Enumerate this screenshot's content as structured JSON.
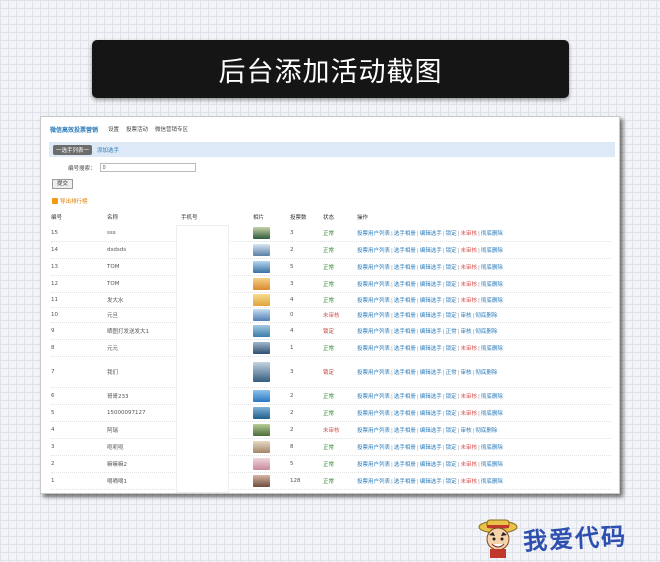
{
  "banner": {
    "title": "后台添加活动截图"
  },
  "nav": {
    "brand": "微信高效投票营销",
    "links": [
      "设置",
      "投票活动",
      "微信营销专区"
    ]
  },
  "subbar": {
    "active_tab": "一选手列表一",
    "add_tab": "添加选手"
  },
  "search": {
    "label": "编号搜索：",
    "value": "0"
  },
  "submit_label": "提交",
  "export_label": "导出排行榜",
  "columns": [
    "编号",
    "名称",
    "手机号",
    "相片",
    "投票数",
    "状态",
    "操作"
  ],
  "rows": [
    {
      "id": "15",
      "name": "sss",
      "votes": "3",
      "status": "正常",
      "status_type": "normal",
      "action3": "锁定",
      "action4": "未审核",
      "photo": [
        "#2f5a3c",
        "#c7d3a8"
      ]
    },
    {
      "id": "14",
      "name": "dsdsds",
      "votes": "2",
      "status": "正常",
      "status_type": "normal",
      "action3": "锁定",
      "action4": "未审核",
      "photo": [
        "#5a7fa8",
        "#d8e6f0"
      ]
    },
    {
      "id": "13",
      "name": "TOM",
      "votes": "5",
      "status": "正常",
      "status_type": "normal",
      "action3": "锁定",
      "action4": "未审核",
      "photo": [
        "#3b6fa3",
        "#b6d7ee"
      ]
    },
    {
      "id": "12",
      "name": "TOM",
      "votes": "3",
      "status": "正常",
      "status_type": "normal",
      "action3": "锁定",
      "action4": "未审核",
      "photo": [
        "#d98a2c",
        "#f3d28a"
      ]
    },
    {
      "id": "11",
      "name": "发大水",
      "votes": "4",
      "status": "正常",
      "status_type": "normal",
      "action3": "锁定",
      "action4": "未审核",
      "photo": [
        "#e0a33a",
        "#f7dc8e"
      ]
    },
    {
      "id": "10",
      "name": "元旦",
      "votes": "0",
      "status": "未审核",
      "status_type": "pending",
      "action3": "锁定",
      "action4": "审核",
      "photo": [
        "#4e7fb5",
        "#c9def0"
      ]
    },
    {
      "id": "9",
      "name": "晒图打发送发大1",
      "votes": "4",
      "status": "锁定",
      "status_type": "locked",
      "action3": "正常",
      "action4": "审核",
      "photo": [
        "#3c7ca9",
        "#a4c9e3"
      ]
    },
    {
      "id": "8",
      "name": "元元",
      "votes": "1",
      "status": "正常",
      "status_type": "normal",
      "action3": "锁定",
      "action4": "未审核",
      "photo": [
        "#2f4f6e",
        "#9fb7cc"
      ]
    },
    {
      "id": "7",
      "name": "我们",
      "votes": "3",
      "status": "锁定",
      "status_type": "locked",
      "action3": "正常",
      "action4": "审核",
      "photo": [
        "#355c7d",
        "#c2d4e2"
      ]
    },
    {
      "id": "6",
      "name": "哥哥233",
      "votes": "2",
      "status": "正常",
      "status_type": "normal",
      "action3": "锁定",
      "action4": "未审核",
      "photo": [
        "#2a78c2",
        "#8ec2ea"
      ]
    },
    {
      "id": "5",
      "name": "15000097127",
      "votes": "2",
      "status": "正常",
      "status_type": "normal",
      "action3": "锁定",
      "action4": "未审核",
      "photo": [
        "#1f5f8b",
        "#7fb3d8"
      ]
    },
    {
      "id": "4",
      "name": "阿瑞",
      "votes": "2",
      "status": "未审核",
      "status_type": "pending",
      "action3": "锁定",
      "action4": "审核",
      "photo": [
        "#4d6b3a",
        "#b6cf95"
      ]
    },
    {
      "id": "3",
      "name": "呃呃呃",
      "votes": "8",
      "status": "正常",
      "status_type": "normal",
      "action3": "锁定",
      "action4": "未审核",
      "photo": [
        "#a3866b",
        "#e8d8c4"
      ]
    },
    {
      "id": "2",
      "name": "嘛嘛嘛2",
      "votes": "5",
      "status": "正常",
      "status_type": "normal",
      "action3": "锁定",
      "action4": "未审核",
      "photo": [
        "#c58b9a",
        "#f0d6dc"
      ]
    },
    {
      "id": "1",
      "name": "嘀嘀嘀1",
      "votes": "128",
      "status": "正常",
      "status_type": "normal",
      "action3": "锁定",
      "action4": "未审核",
      "photo": [
        "#6e4c3f",
        "#d8b6a3"
      ]
    }
  ],
  "actions_common": {
    "a1": "投票用户列表",
    "a2": "选手相册",
    "a3": "编辑选手",
    "a5": "彻底删除"
  },
  "logo": {
    "text": "我爱代码"
  },
  "colors": {
    "link": "#2b7bb9",
    "status_normal": "#2e8b2e",
    "status_pending": "#d9534f",
    "status_locked": "#c0392b",
    "brand_blue": "#2d4fb0"
  }
}
